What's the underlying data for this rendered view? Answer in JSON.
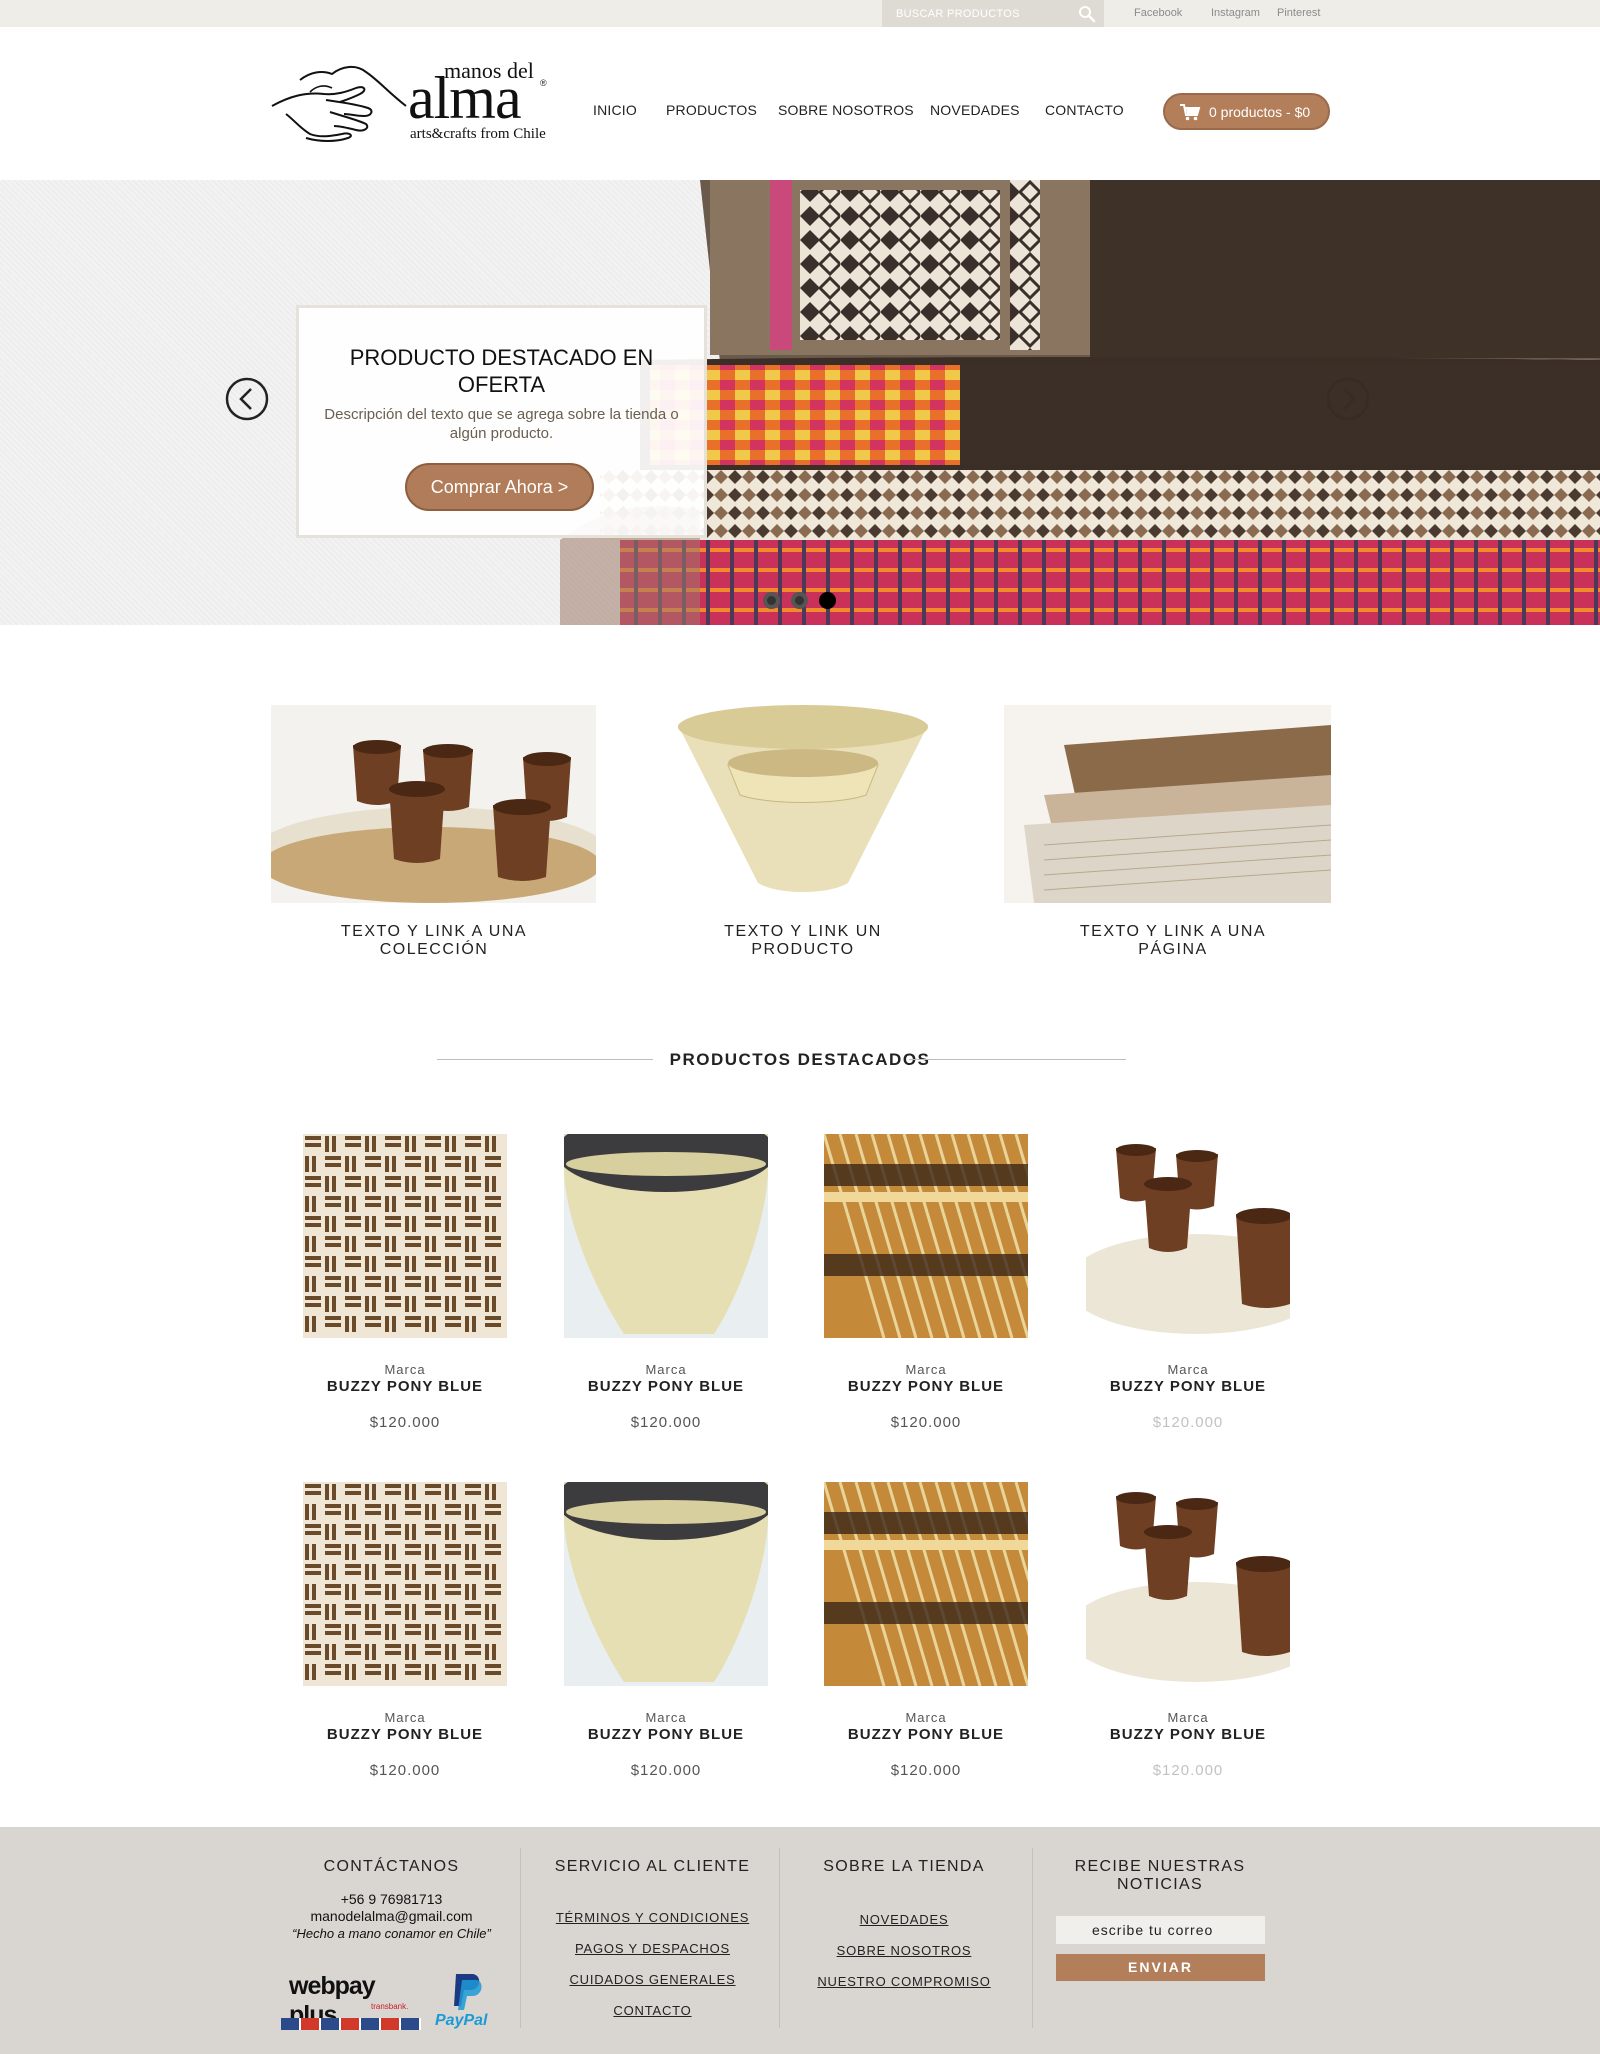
{
  "topbar": {
    "search_placeholder": "BUSCAR PRODUCTOS",
    "social": [
      "Facebook",
      "Instagram",
      "Pinterest"
    ]
  },
  "header": {
    "logo": {
      "top": "manos del",
      "main": "alma",
      "sub": "arts&crafts from Chile",
      "mark": "®"
    },
    "nav": [
      "INICIO",
      "PRODUCTOS",
      "SOBRE NOSOTROS",
      "NOVEDADES",
      "CONTACTO"
    ],
    "cart_label": "0 productos - $0"
  },
  "hero": {
    "title": "PRODUCTO DESTACADO EN OFERTA",
    "description": "Descripción del texto que se agrega sobre la tienda o algún producto.",
    "button": "Comprar Ahora >",
    "slide_count": 3,
    "active_slide": 3
  },
  "collections": [
    {
      "label": "TEXTO Y LINK A UNA COLECCIÓN"
    },
    {
      "label": "TEXTO Y LINK UN PRODUCTO"
    },
    {
      "label": "TEXTO Y LINK A UNA PÁGINA"
    }
  ],
  "featured": {
    "title": "PRODUCTOS DESTACADOS",
    "products": [
      {
        "brand": "Marca",
        "name": "BUZZY PONY BLUE",
        "price": "$120.000",
        "image": "woven-cushion"
      },
      {
        "brand": "Marca",
        "name": "BUZZY PONY BLUE",
        "price": "$120.000",
        "image": "ceramic-bowl"
      },
      {
        "brand": "Marca",
        "name": "BUZZY PONY BLUE",
        "price": "$120.000",
        "image": "woven-placemats"
      },
      {
        "brand": "Marca",
        "name": "BUZZY PONY BLUE",
        "price": "$120.000",
        "image": "ceramic-cups"
      },
      {
        "brand": "Marca",
        "name": "BUZZY PONY BLUE",
        "price": "$120.000",
        "image": "woven-cushion"
      },
      {
        "brand": "Marca",
        "name": "BUZZY PONY BLUE",
        "price": "$120.000",
        "image": "ceramic-bowl"
      },
      {
        "brand": "Marca",
        "name": "BUZZY PONY BLUE",
        "price": "$120.000",
        "image": "woven-placemats"
      },
      {
        "brand": "Marca",
        "name": "BUZZY PONY BLUE",
        "price": "$120.000",
        "image": "ceramic-cups"
      }
    ]
  },
  "footer": {
    "contact": {
      "title": "CONTÁCTANOS",
      "phone": "+56 9 76981713",
      "email": "manodelalma@gmail.com",
      "tagline": "“Hecho a mano conamor en Chile”",
      "payment_logos": [
        "webpay plus",
        "transbank.",
        "PayPal"
      ]
    },
    "service": {
      "title": "SERVICIO AL CLIENTE",
      "links": [
        "TÉRMINOS Y CONDICIONES",
        "PAGOS Y DESPACHOS",
        "CUIDADOS GENERALES",
        "CONTACTO"
      ]
    },
    "about": {
      "title": "SOBRE LA TIENDA",
      "links": [
        "NOVEDADES",
        "SOBRE NOSOTROS",
        "NUESTRO COMPROMISO"
      ]
    },
    "newsletter": {
      "title": "RECIBE NUESTRAS NOTICIAS",
      "placeholder": "escribe tu correo",
      "button": "ENVIAR"
    }
  },
  "colors": {
    "accent": "#b37e5a",
    "topbar": "#efede8",
    "footer": "#d9d6d1"
  }
}
